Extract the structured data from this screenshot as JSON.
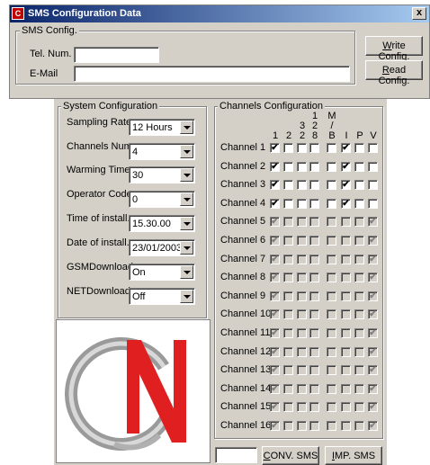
{
  "window": {
    "title": "SMS Configuration Data",
    "close": "x"
  },
  "sms_config": {
    "group_label": "SMS Config.",
    "tel_label": "Tel. Num.",
    "tel_value": "",
    "email_label": "E-Mail",
    "email_value": "",
    "write_btn_pre": "W",
    "write_btn_rest": "rite Config.",
    "read_btn_pre": "R",
    "read_btn_rest": "ead Config."
  },
  "system": {
    "group_label": "System Configuration",
    "fields": [
      {
        "label": "Sampling Rate",
        "value": "12 Hours"
      },
      {
        "label": "Channels Num.",
        "value": "4"
      },
      {
        "label": "Warming Time",
        "value": "30"
      },
      {
        "label": "Operator Code",
        "value": "0"
      },
      {
        "label": "Time of install.",
        "value": "15.30.00"
      },
      {
        "label": "Date of install.",
        "value": "23/01/2003"
      },
      {
        "label": "GSMDownload",
        "value": "On"
      },
      {
        "label": "NETDownload",
        "value": "Off"
      }
    ]
  },
  "channels": {
    "group_label": "Channels Configuration",
    "headers": [
      {
        "lines": [
          "",
          "",
          "1"
        ]
      },
      {
        "lines": [
          "",
          "3",
          "2"
        ]
      },
      {
        "lines": [
          "1",
          "2",
          "8"
        ]
      }
    ],
    "col_headers": [
      "1",
      "2",
      "32",
      "128",
      "M/B",
      "I",
      "P",
      "V"
    ],
    "rows": [
      {
        "label": "Channel 1",
        "checks": [
          1,
          0,
          0,
          0,
          0,
          1,
          0,
          0
        ],
        "enabled": true
      },
      {
        "label": "Channel 2",
        "checks": [
          1,
          0,
          0,
          0,
          0,
          1,
          0,
          0
        ],
        "enabled": true
      },
      {
        "label": "Channel 3",
        "checks": [
          1,
          0,
          0,
          0,
          0,
          1,
          0,
          0
        ],
        "enabled": true
      },
      {
        "label": "Channel 4",
        "checks": [
          1,
          0,
          0,
          0,
          0,
          1,
          0,
          0
        ],
        "enabled": true
      },
      {
        "label": "Channel 5",
        "checks": [
          1,
          0,
          0,
          0,
          0,
          0,
          0,
          1
        ],
        "enabled": false
      },
      {
        "label": "Channel 6",
        "checks": [
          1,
          0,
          0,
          0,
          0,
          0,
          0,
          1
        ],
        "enabled": false
      },
      {
        "label": "Channel 7",
        "checks": [
          1,
          0,
          0,
          0,
          0,
          0,
          0,
          1
        ],
        "enabled": false
      },
      {
        "label": "Channel 8",
        "checks": [
          1,
          0,
          0,
          0,
          0,
          0,
          0,
          1
        ],
        "enabled": false
      },
      {
        "label": "Channel 9",
        "checks": [
          1,
          0,
          0,
          0,
          0,
          0,
          0,
          1
        ],
        "enabled": false
      },
      {
        "label": "Channel 10",
        "checks": [
          1,
          0,
          0,
          0,
          0,
          0,
          0,
          1
        ],
        "enabled": false
      },
      {
        "label": "Channel 11",
        "checks": [
          1,
          0,
          0,
          0,
          0,
          0,
          0,
          1
        ],
        "enabled": false
      },
      {
        "label": "Channel 12",
        "checks": [
          1,
          0,
          0,
          0,
          0,
          0,
          0,
          1
        ],
        "enabled": false
      },
      {
        "label": "Channel 13",
        "checks": [
          1,
          0,
          0,
          0,
          0,
          0,
          0,
          1
        ],
        "enabled": false
      },
      {
        "label": "Channel 14",
        "checks": [
          1,
          0,
          0,
          0,
          0,
          0,
          0,
          1
        ],
        "enabled": false
      },
      {
        "label": "Channel 15",
        "checks": [
          1,
          0,
          0,
          0,
          0,
          0,
          0,
          1
        ],
        "enabled": false
      },
      {
        "label": "Channel 16",
        "checks": [
          1,
          0,
          0,
          0,
          0,
          0,
          0,
          1
        ],
        "enabled": false
      }
    ]
  },
  "bottom": {
    "sms_value": "",
    "conv_pre": "C",
    "conv_rest": "ONV. SMS",
    "imp_pre": "I",
    "imp_rest": "MP. SMS"
  },
  "logo": {
    "text": "GN",
    "colors": {
      "g": "#8a8a8a",
      "n": "#e02020"
    }
  }
}
